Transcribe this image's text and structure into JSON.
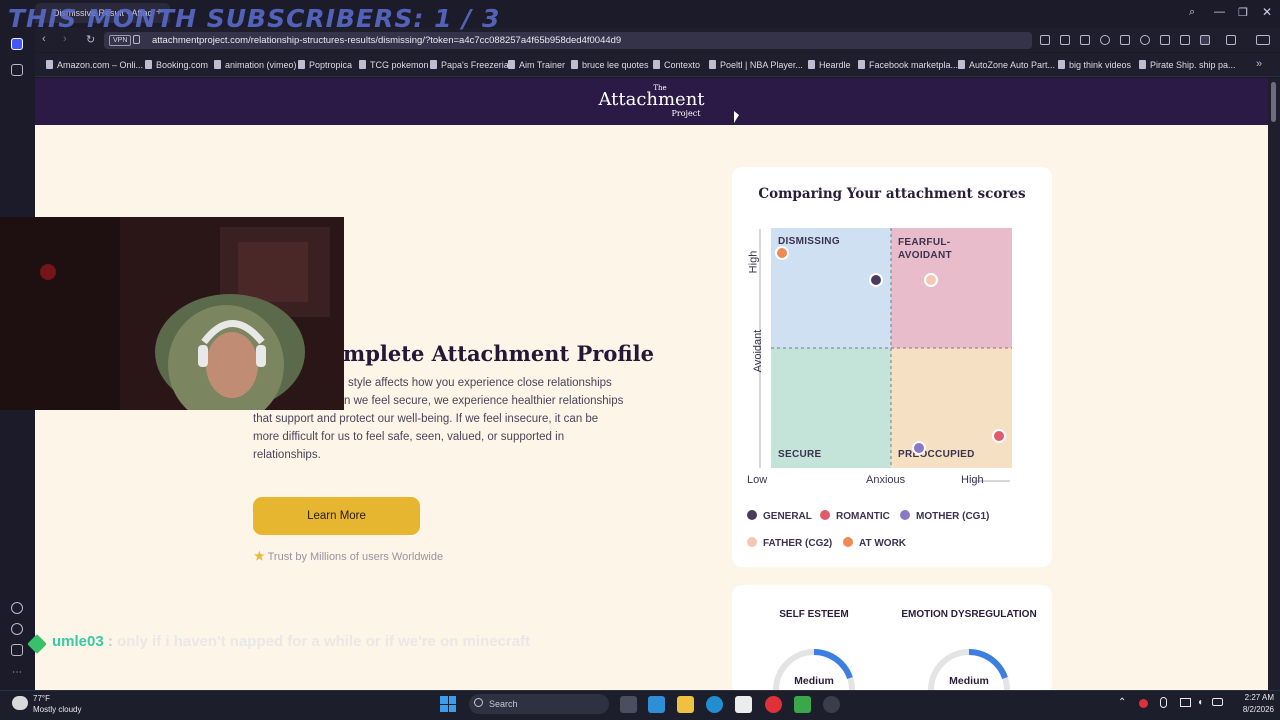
{
  "browser": {
    "tab_title": "Dismissive Result - Attac",
    "url": "attachmentproject.com/relationship-structures-results/dismissing/?token=a4c7cc088257a4f65b958ded4f0044d9",
    "vpn_label": "VPN",
    "bookmarks": [
      "Amazon.com – Onli...",
      "Booking.com",
      "animation (vimeo)",
      "Poptropica",
      "TCG pokemon",
      "Papa's Freezeria",
      "Aim Trainer",
      "bruce lee quotes",
      "Contexto",
      "Poeltl | NBA Player...",
      "Heardle",
      "Facebook marketpla...",
      "AutoZone Auto Part...",
      "big think videos",
      "Pirate Ship. ship pa..."
    ]
  },
  "overlay": {
    "subscribers": "THIS MONTH SUBSCRIBERS: 1 / 3",
    "chat_user": "umle03",
    "chat_sep": ":",
    "chat_message": "only if i haven't napped for a while or if we're on minecraft"
  },
  "site": {
    "logo_the": "The",
    "logo_main": "Attachment",
    "logo_sub": "Project"
  },
  "profile": {
    "title": "mplete Attachment Profile",
    "lines": [
      "style affects how you experience close relationships",
      "n we feel secure, we experience healthier relationships",
      "that support and protect our well-being. If we feel insecure, it can be",
      "more difficult for us to feel safe, seen, valued, or supported in",
      "relationships."
    ],
    "button": "Learn More",
    "trust_icon": "★",
    "trust": "Trust by Millions of users Worldwide"
  },
  "chart_data": {
    "type": "scatter",
    "title": "Comparing Your attachment scores",
    "xlabel": "Anxious",
    "ylabel": "Avoidant",
    "x_ticks": [
      "Low",
      "High"
    ],
    "y_ticks": [
      "High"
    ],
    "xlim": [
      0,
      1
    ],
    "ylim": [
      0,
      1
    ],
    "quadrants": [
      "DISMISSING",
      "FEARFUL-AVOIDANT",
      "SECURE",
      "PREOCCUPIED"
    ],
    "legend_position": "bottom",
    "series": [
      {
        "name": "GENERAL",
        "color": "#4a3a5c",
        "x": 0.44,
        "y": 0.78
      },
      {
        "name": "ROMANTIC",
        "color": "#e05a6a",
        "x": 0.95,
        "y": 0.13
      },
      {
        "name": "MOTHER (CG1)",
        "color": "#8b78c2",
        "x": 0.62,
        "y": 0.08
      },
      {
        "name": "FATHER (CG2)",
        "color": "#f6c6b6",
        "x": 0.67,
        "y": 0.78
      },
      {
        "name": "AT WORK",
        "color": "#f08a55",
        "x": 0.05,
        "y": 0.89
      }
    ]
  },
  "scores": {
    "left_label": "SELF ESTEEM",
    "left_value": "Medium",
    "right_label": "EMOTION DYSREGULATION",
    "right_value": "Medium"
  },
  "taskbar": {
    "temp": "77°F",
    "weather": "Mostly cloudy",
    "search": "Search",
    "time": "2:27 AM",
    "date": "8/2/2026"
  }
}
